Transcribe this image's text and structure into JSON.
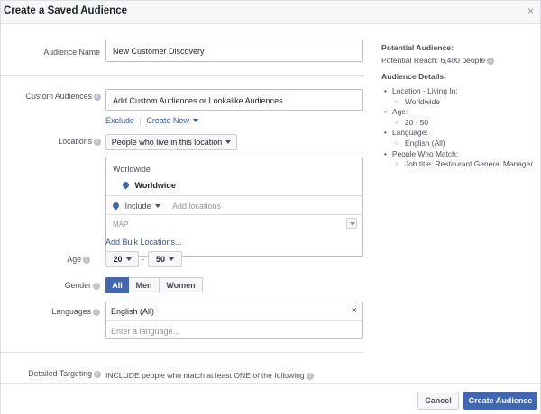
{
  "dialog": {
    "title": "Create a Saved Audience",
    "close_symbol": "×"
  },
  "form": {
    "audience_name": {
      "label": "Audience Name",
      "value": "New Customer Discovery"
    },
    "custom_audiences": {
      "label": "Custom Audiences",
      "placeholder": "Add Custom Audiences or Lookalike Audiences",
      "exclude_label": "Exclude",
      "create_new_label": "Create New"
    },
    "locations": {
      "label": "Locations",
      "dropdown_value": "People who live in this location",
      "group_header": "Worldwide",
      "selected": "Worldwide",
      "include_label": "Include",
      "add_placeholder": "Add locations",
      "map_label": "MAP",
      "bulk_link": "Add Bulk Locations..."
    },
    "age": {
      "label": "Age",
      "min": "20",
      "max": "50",
      "separator": "-"
    },
    "gender": {
      "label": "Gender",
      "options": [
        "All",
        "Men",
        "Women"
      ],
      "selected": "All"
    },
    "languages": {
      "label": "Languages",
      "selected": "English (All)",
      "placeholder": "Enter a language..."
    },
    "detailed_targeting": {
      "label": "Detailed Targeting",
      "text": "INCLUDE people who match at least ONE of the following"
    }
  },
  "summary": {
    "potential_audience_title": "Potential Audience:",
    "potential_reach": "Potential Reach: 6,400 people",
    "details_title": "Audience Details:",
    "details": [
      {
        "text": "Location - Living In:",
        "level": 1
      },
      {
        "text": "Worldwide",
        "level": 2
      },
      {
        "text": "Age:",
        "level": 1
      },
      {
        "text": "20 - 50",
        "level": 2
      },
      {
        "text": "Language:",
        "level": 1
      },
      {
        "text": "English (All)",
        "level": 2
      },
      {
        "text": "People Who Match:",
        "level": 1
      },
      {
        "text": "Job title: Restaurant General Manager",
        "level": 2
      }
    ]
  },
  "footer": {
    "cancel_label": "Cancel",
    "create_label": "Create Audience"
  },
  "colors": {
    "primary": "#4267b2",
    "link": "#365899"
  },
  "icons": [
    "close-icon",
    "info-icon",
    "map-pin-icon",
    "caret-down-icon",
    "remove-icon"
  ]
}
